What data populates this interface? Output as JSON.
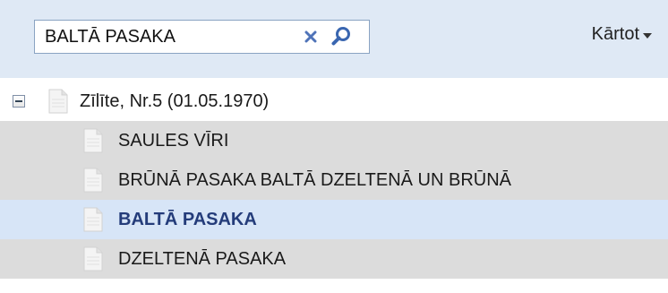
{
  "search": {
    "value": "BALTĀ PASAKA",
    "clear_icon": "close-icon",
    "search_icon": "magnifier-icon"
  },
  "sort": {
    "label": "Kārtot"
  },
  "tree": {
    "parent": {
      "label": "Zīlīte, Nr.5 (01.05.1970)",
      "expanded": true
    },
    "children": [
      {
        "label": "SAULES VĪRI",
        "selected": false
      },
      {
        "label": "BRŪNĀ PASAKA BALTĀ DZELTENĀ UN BRŪNĀ",
        "selected": false
      },
      {
        "label": "BALTĀ PASAKA",
        "selected": true
      },
      {
        "label": "DZELTENĀ PASAKA",
        "selected": false
      }
    ]
  },
  "colors": {
    "toolbar_bg": "#dfe9f5",
    "row_bg": "#dcdcdc",
    "selected_bg": "#d7e5f7",
    "selected_text": "#243c7a",
    "clear_icon": "#4f73b8",
    "search_icon": "#3a66b0"
  }
}
